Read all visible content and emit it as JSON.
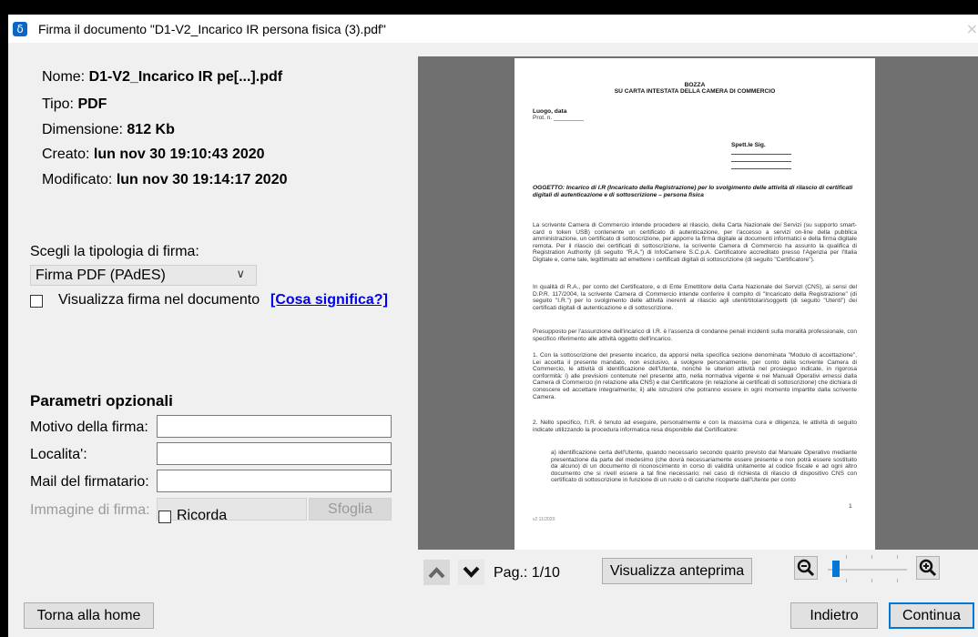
{
  "window": {
    "title": "Firma il documento \"D1-V2_Incarico IR persona fisica (3).pdf\"",
    "app_icon": "δ",
    "close_glyph": "×"
  },
  "file_info": {
    "name_label": "Nome:",
    "name_value": "D1-V2_Incarico IR pe[...].pdf",
    "type_label": "Tipo:",
    "type_value": "PDF",
    "size_label": "Dimensione:",
    "size_value": "812 Kb",
    "created_label": "Creato:",
    "created_value": "lun nov 30 19:10:43 2020",
    "modified_label": "Modificato:",
    "modified_value": "lun nov 30 19:14:17 2020"
  },
  "signature": {
    "type_label": "Scegli la tipologia di firma:",
    "type_selected": "Firma PDF (PAdES)",
    "show_sig_label": "Visualizza firma nel documento",
    "show_sig_checked": false,
    "what_link": "[Cosa significa?]"
  },
  "optional": {
    "title": "Parametri opzionali",
    "reason_label": "Motivo della firma:",
    "reason_value": "",
    "location_label": "Localita':",
    "location_value": "",
    "email_label": "Mail del firmatario:",
    "email_value": "",
    "image_label": "Immagine di firma:",
    "image_value": "",
    "browse_label": "Sfoglia",
    "remember_label": "Ricorda",
    "remember_checked": false
  },
  "preview": {
    "page_label": "Pag.: 1/10",
    "preview_button": "Visualizza anteprima",
    "zoom_out_icon": "zoom-out",
    "zoom_in_icon": "zoom-in",
    "zoom_level": 0.06,
    "doc": {
      "header1": "BOZZA",
      "header2": "SU CARTA INTESTATA DELLA CAMERA DI COMMERCIO",
      "place_date": "Luogo, data",
      "prot": "Prot. n. _________",
      "recipient": "Spett.le Sig.",
      "subject": "OGGETTO: Incarico di I.R (Incaricato della Registrazione) per lo svolgimento delle attività di rilascio di certificati digitali di autenticazione e di sottoscrizione – persona fisica",
      "p1": "La scrivente Camera di Commercio intende procedere al rilascio, della Carta Nazionale dei Servizi (su supporto smart-card o token USB) contenente un certificato di autenticazione, per l'accesso a servizi on-line della pubblica amministrazione, un certificato di sottoscrizione, per apporre la firma digitale ai documenti informatici e della firma digitale remota. Per il rilascio dei certificati di sottoscrizione, la scrivente Camera di Commercio ha assunto la qualifica di Registration Authority (di seguito \"R.A.\") di InfoCamere S.C.p.A. Certificatore accreditato presso l'Agenzia per l'Italia Digitale e, come tale, legittimato ad emettere i certificati digitali di sottoscrizione (di seguito \"Certificatore\").",
      "p2": "In qualità di R.A., per conto del Certificatore, e di Ente Emettitore della Carta Nazionale dei Servizi (CNS), ai sensi del D.P.R. 117/2004, la scrivente Camera di Commercio intende conferire il compito di \"Incaricato della Registrazione\" (di seguito \"I.R.\") per lo svolgimento delle attività inerenti al rilascio agli utenti/titolari/soggetti (di seguito \"Utenti\") dei certificati digitali di autenticazione e di sottoscrizione.",
      "p3": "Presupposto per l'assunzione dell'incarico di I.R. è l'assenza di condanne penali incidenti sulla moralità professionale, con specifico riferimento alle attività oggetto dell'incarico.",
      "p4": "1. Con la sottoscrizione del presente incarico, da apporsi nella specifica sezione denominata \"Modulo di accettazione\", Lei accetta il presente mandato, non esclusivo, a svolgere personalmente, per conto della scrivente Camera di Commercio, le attività di identificazione dell'Utente, nonché le ulteriori attività nel prosieguo indicate, in rigorosa conformità: i) alle previsioni contenute nel presente atto, nella normativa vigente e nei Manuali Operativi emessi dalla Camera di Commercio (in relazione alla CNS) e dal Certificatore (in relazione ai certificati di sottoscrizione) che dichiara di conoscere ed accettare integralmente; ii) alle istruzioni che potranno essere in ogni momento impartite dalla scrivente Camera.",
      "p5": "2. Nello specifico, l'I.R. è tenuto ad eseguire, personalmente e con la massima cura e diligenza, le attività di seguito indicate utilizzando la procedura informatica resa disponibile dal Certificatore:",
      "p6": "a) identificazione certa dell'Utente, quando necessario secondo quanto previsto dal Manuale Operativo mediante presentazione da parte del medesimo (che dovrà necessariamente essere presente e non potrà essere sostituito da alcuno) di un documento di riconoscimento in corso di validità unitamente al codice fiscale e ad ogni altro documento che si rivelI essere a tal fine necessario; nel caso di richiesta di rilascio di dispositivo CNS con certificato di sottoscrizione in funzione di un ruolo o di cariche ricoperte dall'Utente per conto",
      "page_no": "1",
      "footer": "v2 11/2020"
    }
  },
  "footer": {
    "home_button": "Torna alla home",
    "back_button": "Indietro",
    "continue_button": "Continua"
  }
}
